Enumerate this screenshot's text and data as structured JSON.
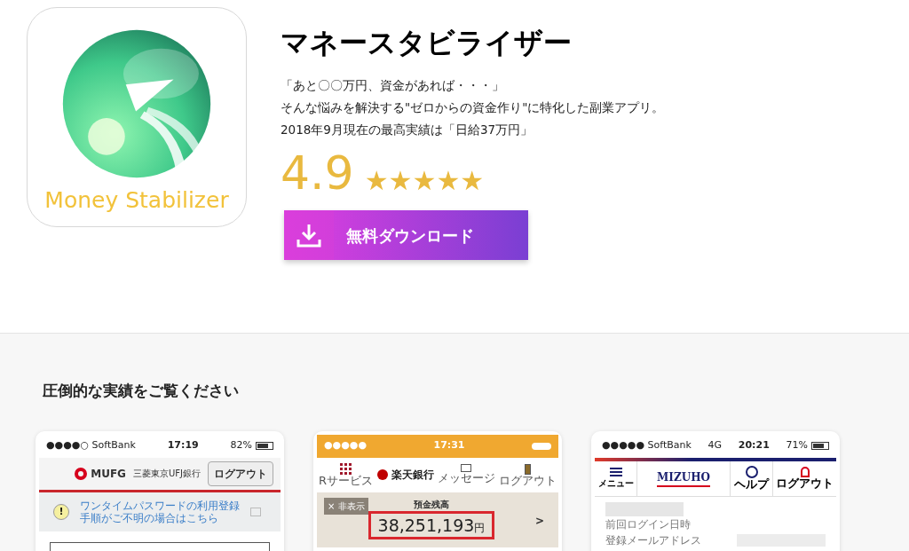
{
  "app": {
    "name": "マネースタビライザー",
    "icon_text": "Money Stabilizer",
    "description": [
      "「あと〇〇万円、資金があれば・・・」",
      "そんな悩みを解決する\"ゼロからの資金作り\"に特化した副業アプリ。",
      "2018年9月現在の最高実績は「日給37万円」"
    ],
    "rating": "4.9",
    "stars": 5,
    "download_button": "無料ダウンロード"
  },
  "section": {
    "heading": "圧倒的な実績をご覧ください",
    "screenshots": [
      {
        "kind": "mufg",
        "carrier": "●●●●○ SoftBank",
        "time": "17:19",
        "battery": "82%",
        "logo": "MUFG",
        "bank_name": "三菱東京UFJ銀行",
        "logout": "ログアウト",
        "warning": "!",
        "notice": "ワンタイムパスワードの利用登録手順がご不明の場合はこちら"
      },
      {
        "kind": "rakuten",
        "carrier": "●●●●●",
        "time": "17:31",
        "service": "Rサービス",
        "logo": "楽天銀行",
        "message": "メッセージ",
        "logout": "ログアウト",
        "hide": "× 非表示",
        "balance_label": "預金残高",
        "amount": "38,251,193",
        "unit": "円",
        "chevron": ">"
      },
      {
        "kind": "mizuho",
        "carrier": "●●●●● SoftBank",
        "network": "4G",
        "time": "20:21",
        "battery": "71%",
        "menu": "メニュー",
        "logo": "MIZUHO",
        "help": "ヘルプ",
        "logout": "ログアウト",
        "rows": [
          "前回ログイン日時",
          "登録メールアドレス"
        ]
      }
    ]
  }
}
